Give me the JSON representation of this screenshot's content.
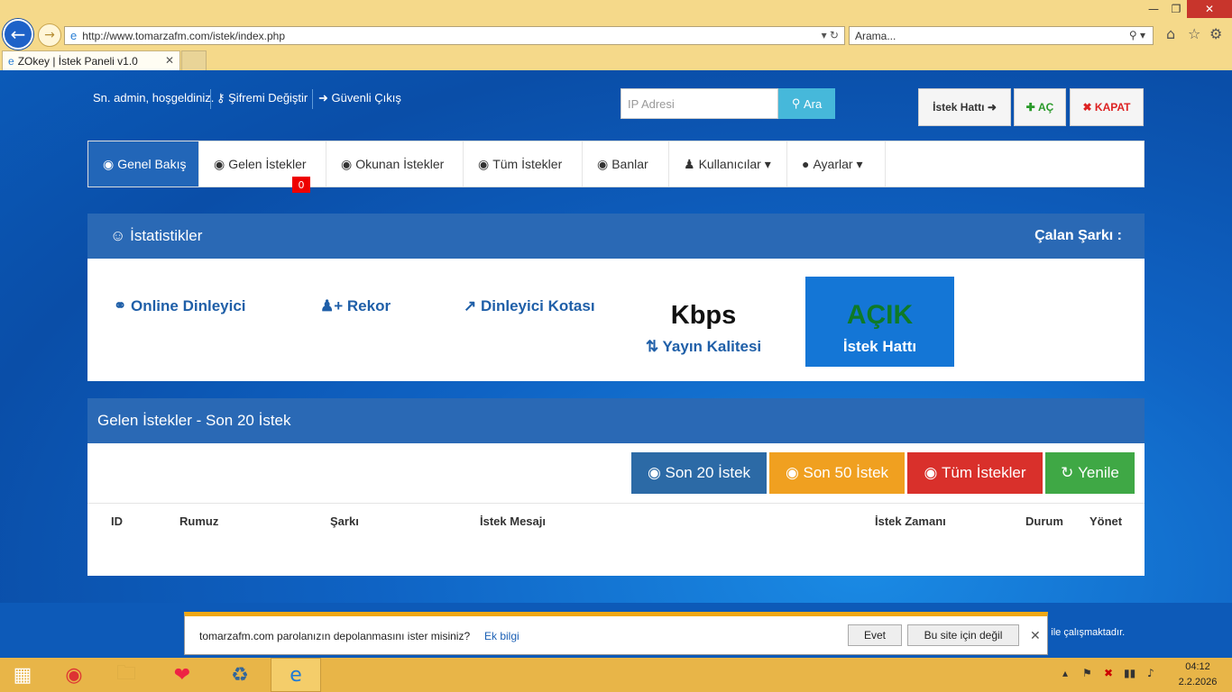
{
  "browser": {
    "url": "http://www.tomarzafm.com/istek/index.php",
    "search_placeholder": "Arama...",
    "tab_title": "ZOkey | İstek Paneli v1.0"
  },
  "topbar": {
    "welcome": "Sn. admin, hoşgeldiniz.",
    "change_password": "Şifremi Değiştir",
    "logout": "Güvenli Çıkış",
    "ip_placeholder": "IP Adresi",
    "search_btn": "Ara",
    "request_line_btn": "İstek Hattı",
    "open_btn": "AÇ",
    "close_btn": "KAPAT"
  },
  "menu": {
    "items": [
      {
        "label": "Genel Bakış"
      },
      {
        "label": "Gelen İstekler"
      },
      {
        "label": "Okunan İstekler"
      },
      {
        "label": "Tüm İstekler"
      },
      {
        "label": "Banlar"
      },
      {
        "label": "Kullanıcılar"
      },
      {
        "label": "Ayarlar"
      }
    ],
    "incoming_badge": "0"
  },
  "stats": {
    "title": "İstatistikler",
    "now_playing": "Çalan Şarkı :",
    "online_listener": "Online Dinleyici",
    "record": "Rekor",
    "listener_quota": "Dinleyici Kotası",
    "kbps": "Kbps",
    "broadcast_quality": "Yayın Kalitesi",
    "request_line_status": "AÇIK",
    "request_line_label": "İstek Hattı"
  },
  "requests": {
    "title": "Gelen İstekler - Son 20 İstek",
    "buttons": [
      "Son 20 İstek",
      "Son 50 İstek",
      "Tüm İstekler",
      "Yenile"
    ],
    "columns": [
      "ID",
      "Rumuz",
      "Şarkı",
      "İstek Mesajı",
      "İstek Zamanı",
      "Durum",
      "Yönet"
    ]
  },
  "footer": {
    "text": "ne ile çalışmaktadır."
  },
  "password_bar": {
    "message": "tomarzafm.com parolanızın depolanmasını ister misiniz?",
    "more": "Ek bilgi",
    "yes": "Evet",
    "not_for_site": "Bu site için değil"
  },
  "taskbar": {
    "time": "04:12",
    "date": "2.2.2026"
  },
  "colors": {
    "panel_header": "#2a69b5",
    "primary": "#2c6aa6",
    "warning": "#f0a020",
    "danger": "#d9302b",
    "success": "#3fa845",
    "open_green": "#0e7a27"
  }
}
